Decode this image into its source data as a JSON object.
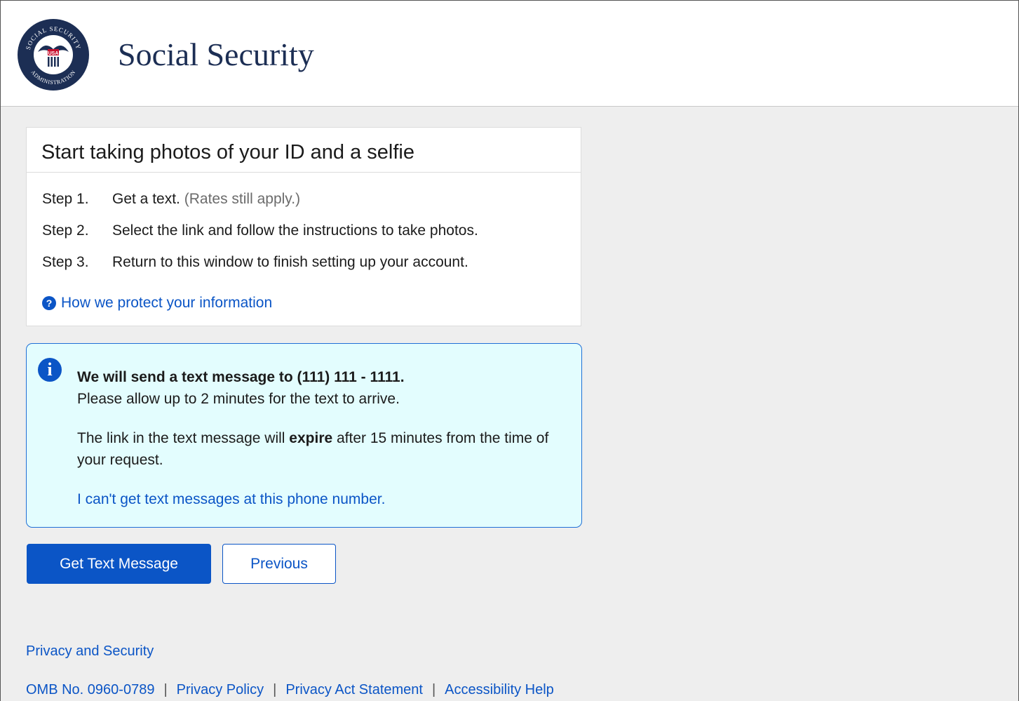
{
  "header": {
    "brand": "Social Security",
    "seal_text": {
      "top": "SOCIAL SECURITY",
      "bottom": "ADMINISTRATION",
      "center": "USA"
    }
  },
  "card": {
    "title": "Start taking photos of your ID and a selfie",
    "steps": [
      {
        "num": "Step 1.",
        "text": "Get a text.",
        "note": "(Rates still apply.)"
      },
      {
        "num": "Step 2.",
        "text": "Select the link and follow the instructions to take photos.",
        "note": ""
      },
      {
        "num": "Step 3.",
        "text": "Return to this window to finish setting up your account.",
        "note": ""
      }
    ],
    "help_link": "How we protect your information"
  },
  "alert": {
    "heading": "We will send a text message to (111) 111 - 1111.",
    "line1": "Please allow up to 2 minutes for the text to arrive.",
    "p2_before": "The link in the text message will ",
    "p2_bold": "expire",
    "p2_after": " after 15 minutes from the time of your request.",
    "link": "I can't get text messages at this phone number."
  },
  "buttons": {
    "primary": "Get Text Message",
    "secondary": "Previous"
  },
  "footer": {
    "privacy_security": "Privacy and Security",
    "omb": "OMB No. 0960-0789",
    "links": [
      "Privacy Policy",
      "Privacy Act Statement",
      "Accessibility Help"
    ]
  },
  "colors": {
    "accent": "#0b55c6",
    "brand_text": "#1c2e54",
    "alert_bg": "#e3fdfe",
    "page_bg": "#eeeeee"
  },
  "icons": {
    "logo": "ssa-seal-icon",
    "help": "question-circle-icon",
    "info": "info-circle-icon"
  }
}
